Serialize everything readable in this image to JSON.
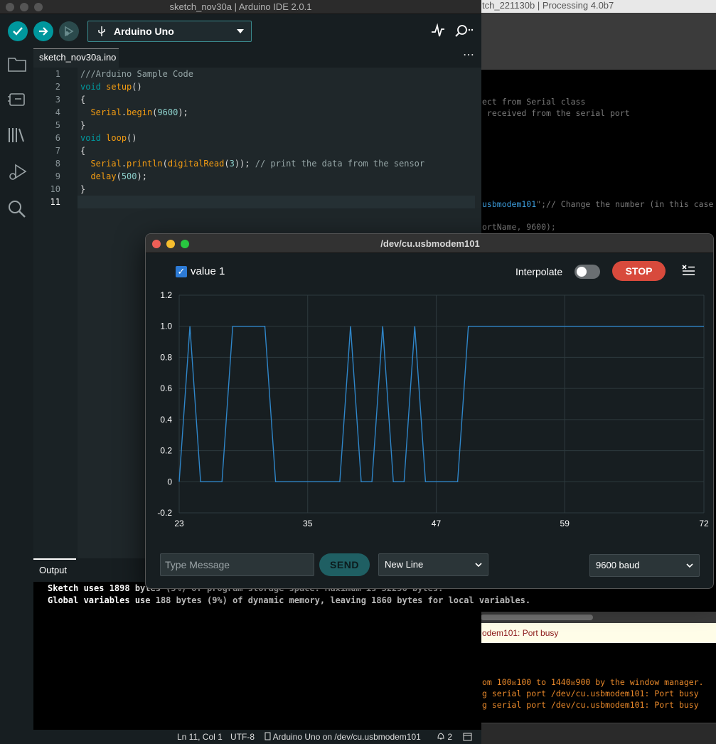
{
  "processing": {
    "title": "tch_221130b | Processing 4.0b7",
    "code_lines": [
      {
        "text": "ect from Serial class",
        "top": 138
      },
      {
        "text": " received from the serial port",
        "top": 154
      },
      {
        "text": "",
        "top": 170
      }
    ],
    "port_line_a": "usbmodem101",
    "port_line_b": "\";// Change the number (in this case",
    "port_line_c": "ortName, 9600);",
    "error_text": "odem101: Port busy",
    "console_lines": [
      "om 100☒100 to 1440☒900 by the window manager.",
      "g serial port /dev/cu.usbmodem101: Port busy",
      "g serial port /dev/cu.usbmodem101: Port busy"
    ]
  },
  "ide": {
    "title": "sketch_nov30a | Arduino IDE 2.0.1",
    "board": "Arduino Uno",
    "tab": "sketch_nov30a.ino",
    "tab_more": "⋯",
    "output_tab": "Output",
    "output_lines": [
      "Sketch uses 1898 bytes (5%) of program storage space. Maximum is 32256 bytes.",
      "Global variables use 188 bytes (9%) of dynamic memory, leaving 1860 bytes for local variables."
    ],
    "status": {
      "position": "Ln 11, Col 1",
      "encoding": "UTF-8",
      "board_port": "Arduino Uno on /dev/cu.usbmodem101",
      "notifications": "2"
    },
    "line_numbers": [
      "1",
      "2",
      "3",
      "4",
      "5",
      "6",
      "7",
      "8",
      "9",
      "10",
      "11"
    ],
    "code": {
      "l1": "///Arduino Sample Code",
      "l2_kw": "void",
      "l2_fn": "setup",
      "l2_rest": "()",
      "l3": "{",
      "l4_obj": "Serial",
      "l4_fn": "begin",
      "l4_num": "9600",
      "l4_rest": ");",
      "l5": "}",
      "l6_kw": "void",
      "l6_fn": "loop",
      "l6_rest": "()",
      "l7": "{",
      "l8_obj": "Serial",
      "l8_fn": "println",
      "l8_fn2": "digitalRead",
      "l8_num": "3",
      "l8_rest": ")); ",
      "l8_cm": "// print the data from the sensor",
      "l9_fn": "delay",
      "l9_num": "500",
      "l9_rest": ");",
      "l10": "}"
    }
  },
  "plotter": {
    "title": "/dev/cu.usbmodem101",
    "legend_check": "✓",
    "legend_label": "value 1",
    "interpolate_label": "Interpolate",
    "stop_label": "STOP",
    "message_placeholder": "Type Message",
    "send_label": "SEND",
    "line_ending": "New Line",
    "baud": "9600 baud"
  },
  "colors": {
    "accent": "#00979d",
    "series": "#2f86c9",
    "stop": "#d84a3c"
  },
  "chart_data": {
    "type": "line",
    "series": [
      {
        "name": "value 1"
      }
    ],
    "x": [
      23,
      24,
      25,
      26,
      27,
      28,
      29,
      30,
      31,
      32,
      33,
      34,
      35,
      36,
      37,
      38,
      39,
      40,
      41,
      42,
      43,
      44,
      45,
      46,
      47,
      48,
      49,
      50,
      51,
      52,
      53,
      54,
      55,
      56,
      57,
      58,
      59,
      60,
      61,
      62,
      63,
      64,
      65,
      66,
      67,
      68,
      69,
      70,
      71,
      72
    ],
    "y": [
      0,
      1,
      0,
      0,
      0,
      1,
      1,
      1,
      1,
      0,
      0,
      0,
      0,
      0,
      0,
      0,
      1,
      0,
      0,
      1,
      0,
      0,
      1,
      0,
      0,
      0,
      0,
      1,
      1,
      1,
      1,
      1,
      1,
      1,
      1,
      1,
      1,
      1,
      1,
      1,
      1,
      1,
      1,
      1,
      1,
      1,
      1,
      1,
      1,
      1
    ],
    "xlim": [
      23,
      72
    ],
    "ylim": [
      -0.2,
      1.2
    ],
    "x_ticks": [
      "23",
      "35",
      "47",
      "59",
      "72"
    ],
    "y_ticks": [
      "1.2",
      "1.0",
      "0.8",
      "0.6",
      "0.4",
      "0.2",
      "0",
      "-0.2"
    ],
    "grid": true
  }
}
